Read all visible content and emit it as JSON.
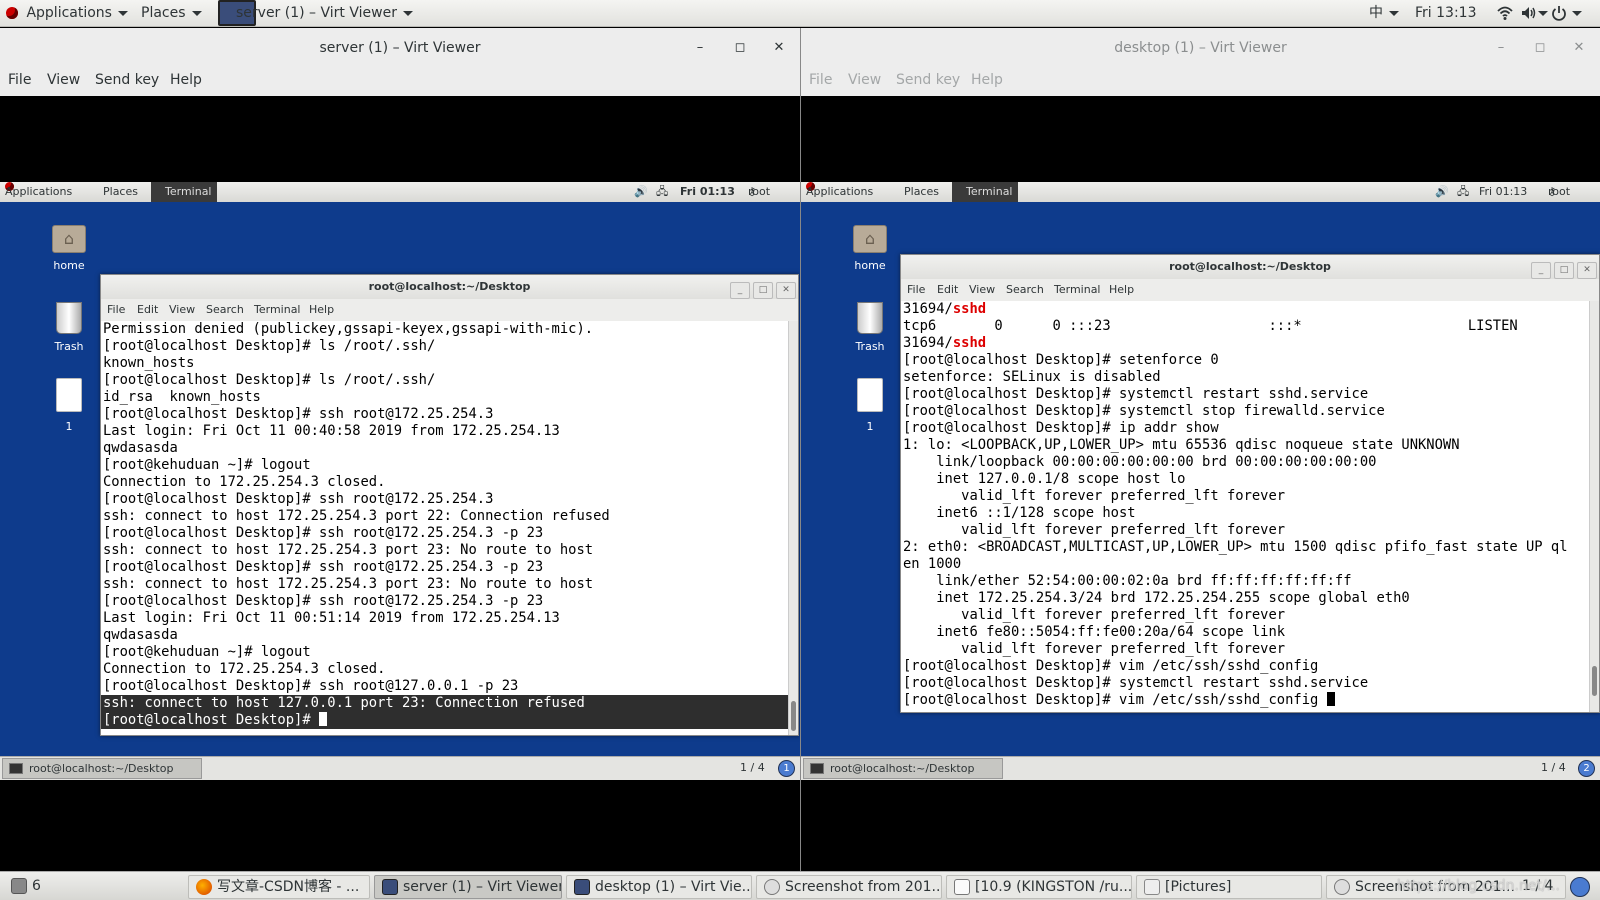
{
  "top_panel": {
    "applications": "Applications",
    "places": "Places",
    "window_menu": "server (1) – Virt Viewer",
    "input_method": "中",
    "clock": "Fri 13:13"
  },
  "server_viewer": {
    "title": "server (1) – Virt Viewer",
    "menu": [
      "File",
      "View",
      "Send key",
      "Help"
    ],
    "guest_panel": {
      "applications": "Applications",
      "places": "Places",
      "terminal": "Terminal",
      "clock": "Fri 01:13",
      "user": "root"
    },
    "desktop_icons": [
      "home",
      "Trash",
      "1"
    ],
    "terminal": {
      "title": "root@localhost:~/Desktop",
      "menu": [
        "File",
        "Edit",
        "View",
        "Search",
        "Terminal",
        "Help"
      ],
      "lines": [
        "Permission denied (publickey,gssapi-keyex,gssapi-with-mic).",
        "[root@localhost Desktop]# ls /root/.ssh/",
        "known_hosts",
        "[root@localhost Desktop]# ls /root/.ssh/",
        "id_rsa  known_hosts",
        "[root@localhost Desktop]# ssh root@172.25.254.3",
        "Last login: Fri Oct 11 00:40:58 2019 from 172.25.254.13",
        "qwdasasda",
        "[root@kehuduan ~]# logout",
        "Connection to 172.25.254.3 closed.",
        "[root@localhost Desktop]# ssh root@172.25.254.3",
        "ssh: connect to host 172.25.254.3 port 22: Connection refused",
        "[root@localhost Desktop]# ssh root@172.25.254.3 -p 23",
        "ssh: connect to host 172.25.254.3 port 23: No route to host",
        "[root@localhost Desktop]# ssh root@172.25.254.3 -p 23",
        "ssh: connect to host 172.25.254.3 port 23: No route to host",
        "[root@localhost Desktop]# ssh root@172.25.254.3 -p 23",
        "Last login: Fri Oct 11 00:51:14 2019 from 172.25.254.13",
        "qwdasasda",
        "[root@kehuduan ~]# logout",
        "Connection to 172.25.254.3 closed.",
        "[root@localhost Desktop]# ssh root@127.0.0.1 -p 23",
        "ssh: connect to host 127.0.0.1 port 23: Connection refused",
        "[root@localhost Desktop]# "
      ]
    },
    "guest_taskbar": {
      "task": "root@localhost:~/Desktop",
      "workspace": "1 / 4",
      "workspace_icon": "1"
    }
  },
  "desktop_viewer": {
    "title": "desktop (1) – Virt Viewer",
    "menu": [
      "File",
      "View",
      "Send key",
      "Help"
    ],
    "guest_panel": {
      "applications": "Applications",
      "places": "Places",
      "terminal": "Terminal",
      "clock": "Fri 01:13",
      "user": "root"
    },
    "desktop_icons": [
      "home",
      "Trash",
      "1"
    ],
    "terminal": {
      "title": "root@localhost:~/Desktop",
      "menu": [
        "File",
        "Edit",
        "View",
        "Search",
        "Terminal",
        "Help"
      ],
      "lines": [
        "31694/sshd",
        "tcp6       0      0 :::23                   :::*                    LISTEN",
        "31694/sshd",
        "[root@localhost Desktop]# setenforce 0",
        "setenforce: SELinux is disabled",
        "[root@localhost Desktop]# systemctl restart sshd.service",
        "[root@localhost Desktop]# systemctl stop firewalld.service",
        "[root@localhost Desktop]# ip addr show",
        "1: lo: <LOOPBACK,UP,LOWER_UP> mtu 65536 qdisc noqueue state UNKNOWN",
        "    link/loopback 00:00:00:00:00:00 brd 00:00:00:00:00:00",
        "    inet 127.0.0.1/8 scope host lo",
        "       valid_lft forever preferred_lft forever",
        "    inet6 ::1/128 scope host",
        "       valid_lft forever preferred_lft forever",
        "2: eth0: <BROADCAST,MULTICAST,UP,LOWER_UP> mtu 1500 qdisc pfifo_fast state UP ql",
        "en 1000",
        "    link/ether 52:54:00:00:02:0a brd ff:ff:ff:ff:ff:ff",
        "    inet 172.25.254.3/24 brd 172.25.254.255 scope global eth0",
        "       valid_lft forever preferred_lft forever",
        "    inet6 fe80::5054:ff:fe00:20a/64 scope link",
        "       valid_lft forever preferred_lft forever",
        "[root@localhost Desktop]# vim /etc/ssh/sshd_config",
        "[root@localhost Desktop]# systemctl restart sshd.service",
        "[root@localhost Desktop]# vim /etc/ssh/sshd_config "
      ]
    },
    "guest_taskbar": {
      "task": "root@localhost:~/Desktop",
      "workspace": "1 / 4",
      "workspace_icon": "2"
    }
  },
  "taskbar": {
    "show_desktop_count": "6",
    "items": [
      "写文章-CSDN博客 - ...",
      "server (1) – Virt Viewer",
      "desktop (1) – Virt Vie...",
      "Screenshot from 201...",
      "[10.9 (KINGSTON /ru...",
      "[Pictures]",
      "Screenshot from 201..."
    ],
    "workspace": "1 / 4",
    "watermark": "https://blog.csdn.net/..."
  },
  "colors": {
    "guest_desktop": "#0e3b8c",
    "highlight_red": "#dd0000",
    "selection_bg": "#2e2e2e"
  }
}
